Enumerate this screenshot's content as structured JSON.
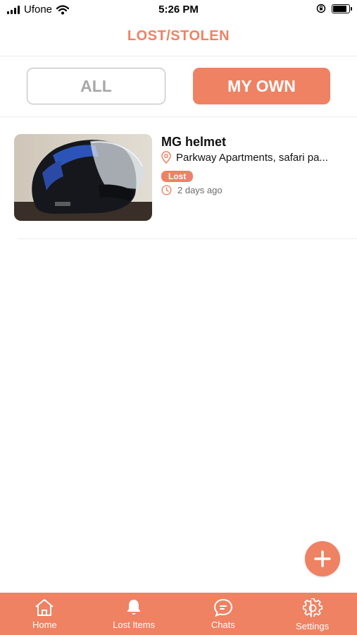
{
  "status_bar": {
    "carrier": "Ufone",
    "time": "5:26 PM"
  },
  "header": {
    "title": "LOST/STOLEN"
  },
  "segments": {
    "all_label": "ALL",
    "mine_label": "MY OWN",
    "selected": "MY OWN"
  },
  "items": [
    {
      "title": "MG helmet",
      "location": "Parkway Apartments, safari pa...",
      "status": "Lost",
      "time_ago": "2 days ago"
    }
  ],
  "bottom_nav": [
    {
      "label": "Home",
      "icon": "home-icon"
    },
    {
      "label": "Lost Items",
      "icon": "bell-icon"
    },
    {
      "label": "Chats",
      "icon": "chat-icon"
    },
    {
      "label": "Settings",
      "icon": "gear-icon"
    }
  ],
  "colors": {
    "accent": "#ef8262",
    "inactive_text": "#a8a8a8",
    "border": "#b7b7b7"
  }
}
